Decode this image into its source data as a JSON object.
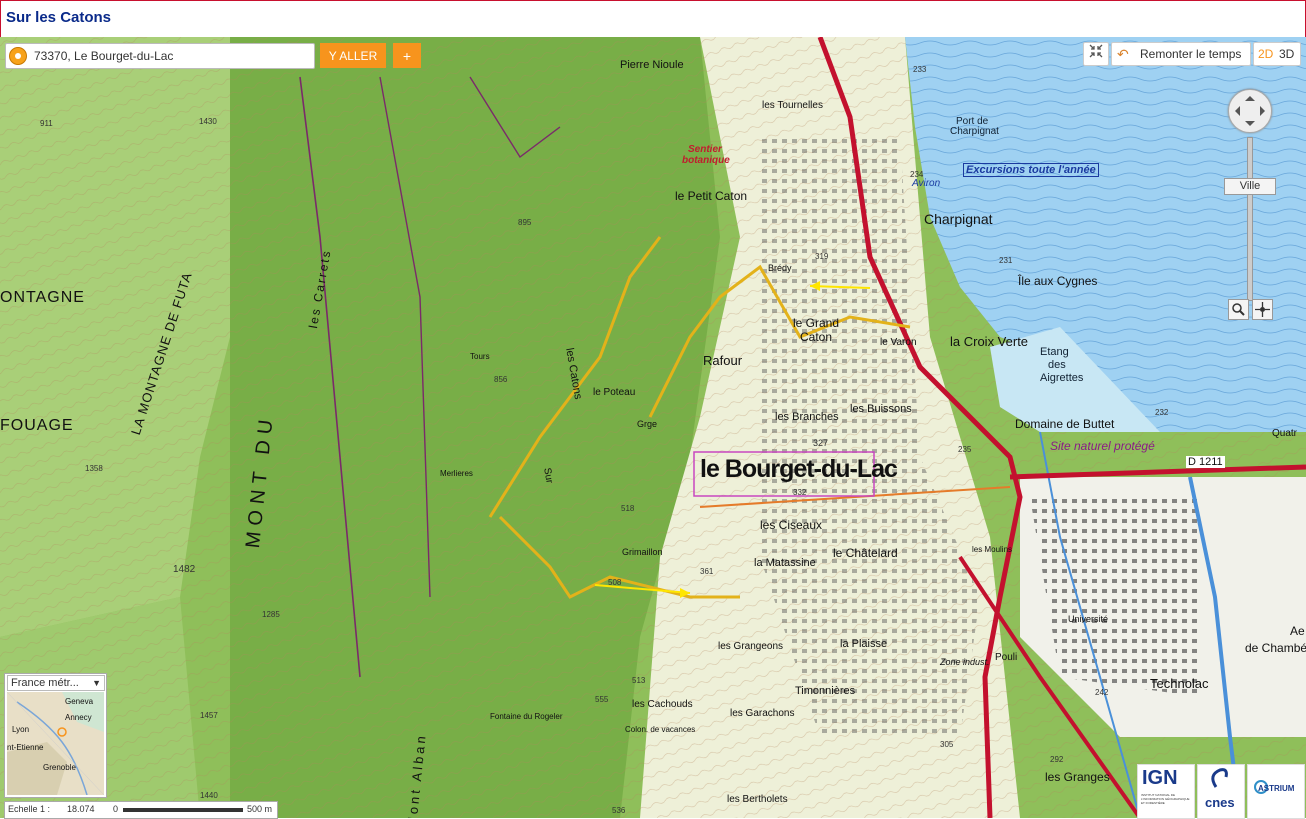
{
  "header": {
    "title": "Sur les Catons"
  },
  "search": {
    "value": "73370, Le Bourget-du-Lac",
    "go_label": "Y ALLER",
    "plus_label": "+"
  },
  "toolbar": {
    "history_label": "Remonter le temps",
    "mode_2d": "2D",
    "mode_3d": "3D"
  },
  "navigation": {
    "zoom_level_label": "Ville"
  },
  "overview": {
    "selected_basemap": "France métr...",
    "places": [
      "Geneva",
      "Annecy",
      "Lyon",
      "nt-Etienne",
      "Grenoble"
    ]
  },
  "scale": {
    "label": "Echelle 1 :",
    "value": "18.074",
    "bar_start": "0",
    "bar_end": "500 m"
  },
  "logos": {
    "ign": "IGN",
    "ign_sub": "INSTITUT NATIONAL DE L'INFORMATION GÉOGRAPHIQUE ET FORESTIÈRE",
    "cnes": "cnes",
    "astrium": "ASTRIUM"
  },
  "map": {
    "labels": {
      "town": "le Bourget-du-Lac",
      "le_petit_caton": "le Petit Caton",
      "pierre_nioule": "Pierre Nioule",
      "les_tournelles": "les Tournelles",
      "port_charpignat_1": "Port de",
      "port_charpignat_2": "Charpignat",
      "excursions": "Excursions toute l'année",
      "aviron": "Aviron",
      "charpignat": "Charpignat",
      "ile_aux_cygnes": "Île aux Cygnes",
      "bredy": "Brédy",
      "le_grand_caton_1": "le Grand",
      "le_grand_caton_2": "Caton",
      "le_varon": "le Varon",
      "la_croix_verte": "la Croix Verte",
      "etang_1": "Etang",
      "etang_2": "des",
      "etang_3": "Aigrettes",
      "rafour": "Rafour",
      "les_branches": "les Branches",
      "les_buissons": "les Buissons",
      "domaine_buttet": "Domaine de Buttet",
      "site_naturel": "Site naturel protégé",
      "d1211": "D 1211",
      "les_catons": "les Catons",
      "sur_les": "Sur",
      "le_poteau": "le Poteau",
      "grge": "Grge",
      "les_ciseaux": "les Ciseaux",
      "le_chatelard": "le Châtelard",
      "la_matassine": "la Matassine",
      "technolac": "Technolac",
      "chambery_1": "Ae",
      "chambery_2": "de Chambé",
      "les_grangeons": "les Grangeons",
      "la_plaisse": "la Plaisse",
      "timonnieres": "Timonnières",
      "zone_indust": "Zone indust.",
      "pouli": "Pouli",
      "les_cachouds": "les Cachouds",
      "les_garachons": "les Garachons",
      "les_granges": "les Granges",
      "les_berthollets": "les Bertholets",
      "sentier_1": "Sentier",
      "sentier_2": "botanique",
      "montagne": "ONTAGNE",
      "fouage": "FOUAGE",
      "la_montagne_de_futa": "LA MONTAGNE DE FUTA",
      "mont_du_chat": "MONT DU",
      "les_carrets": "les Carrets",
      "mont_alban": "Mont Alban",
      "grimaillon": "Grimaillon",
      "marnieres": "Merlieres",
      "fontaine_rogeler": "Fontaine du Rogeler",
      "colon_vacances": "Colon. de vacances",
      "tours": "Tours",
      "les_moulins": "les Moulins",
      "universite": "Université",
      "quatre": "Quatr",
      "e_1482": "1482",
      "e_1358": "1358",
      "e_1285": "1285",
      "e_1457": "1457",
      "e_1440": "1440",
      "e_1430": "1430",
      "e_911": "911",
      "e_895": "895",
      "e_856": "856",
      "e_555": "555",
      "e_536": "536",
      "e_327": "327",
      "e_233": "233",
      "e_234": "234",
      "e_232": "232",
      "e_231": "231",
      "e_235": "235",
      "e_242": "242",
      "e_292": "292",
      "e_305": "305",
      "e_508": "508",
      "e_319": "319",
      "e_332": "332",
      "e_361": "361",
      "e_513": "513",
      "e_518": "518"
    }
  },
  "colors": {
    "accent": "#f7941d",
    "title": "#0a2a8a",
    "lake": "#8ec9ee",
    "forest": "#7fb64e",
    "road": "#c3112e",
    "trail": "#e3b21a"
  }
}
